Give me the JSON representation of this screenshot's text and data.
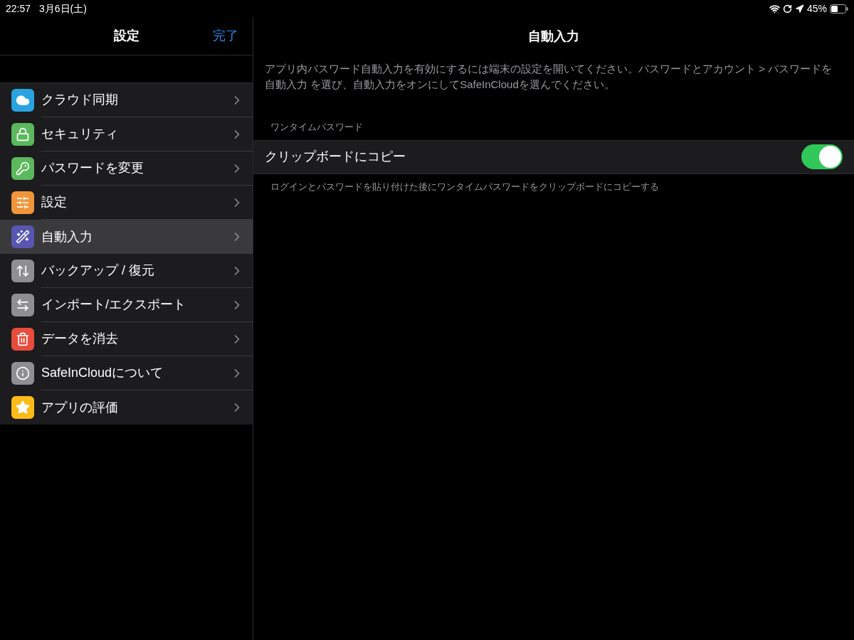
{
  "status_bar": {
    "time": "22:57",
    "date": "3月6日(土)",
    "battery": "45%"
  },
  "sidebar": {
    "title": "設定",
    "done": "完了",
    "items": [
      {
        "label": "クラウド同期",
        "kind": "cloud",
        "color": "#2aa3e0",
        "selected": false
      },
      {
        "label": "セキュリティ",
        "kind": "lock",
        "color": "#5cb85c",
        "selected": false
      },
      {
        "label": "パスワードを変更",
        "kind": "key",
        "color": "#5cb85c",
        "selected": false
      },
      {
        "label": "設定",
        "kind": "sliders",
        "color": "#f0953a",
        "selected": false
      },
      {
        "label": "自動入力",
        "kind": "wand",
        "color": "#5856b0",
        "selected": true
      },
      {
        "label": "バックアップ / 復元",
        "kind": "updown",
        "color": "#8e8e93",
        "selected": false
      },
      {
        "label": "インポート/エクスポート",
        "kind": "leftright",
        "color": "#8e8e93",
        "selected": false
      },
      {
        "label": "データを消去",
        "kind": "trash",
        "color": "#e74c3c",
        "selected": false
      },
      {
        "label": "SafeInCloudについて",
        "kind": "info",
        "color": "#8e8e93",
        "selected": false
      },
      {
        "label": "アプリの評価",
        "kind": "star",
        "color": "#fbbc1a",
        "selected": false
      }
    ]
  },
  "detail": {
    "title": "自動入力",
    "description": "アプリ内パスワード自動入力を有効にするには端末の設定を開いてください。パスワードとアカウント > パスワードを自動入力 を選び、自動入力をオンにしてSafeInCloudを選んでください。",
    "section_header": "ワンタイムパスワード",
    "toggle": {
      "label": "クリップボードにコピー",
      "on": true
    },
    "footer": "ログインとパスワードを貼り付けた後にワンタイムパスワードをクリップボードにコピーする"
  }
}
